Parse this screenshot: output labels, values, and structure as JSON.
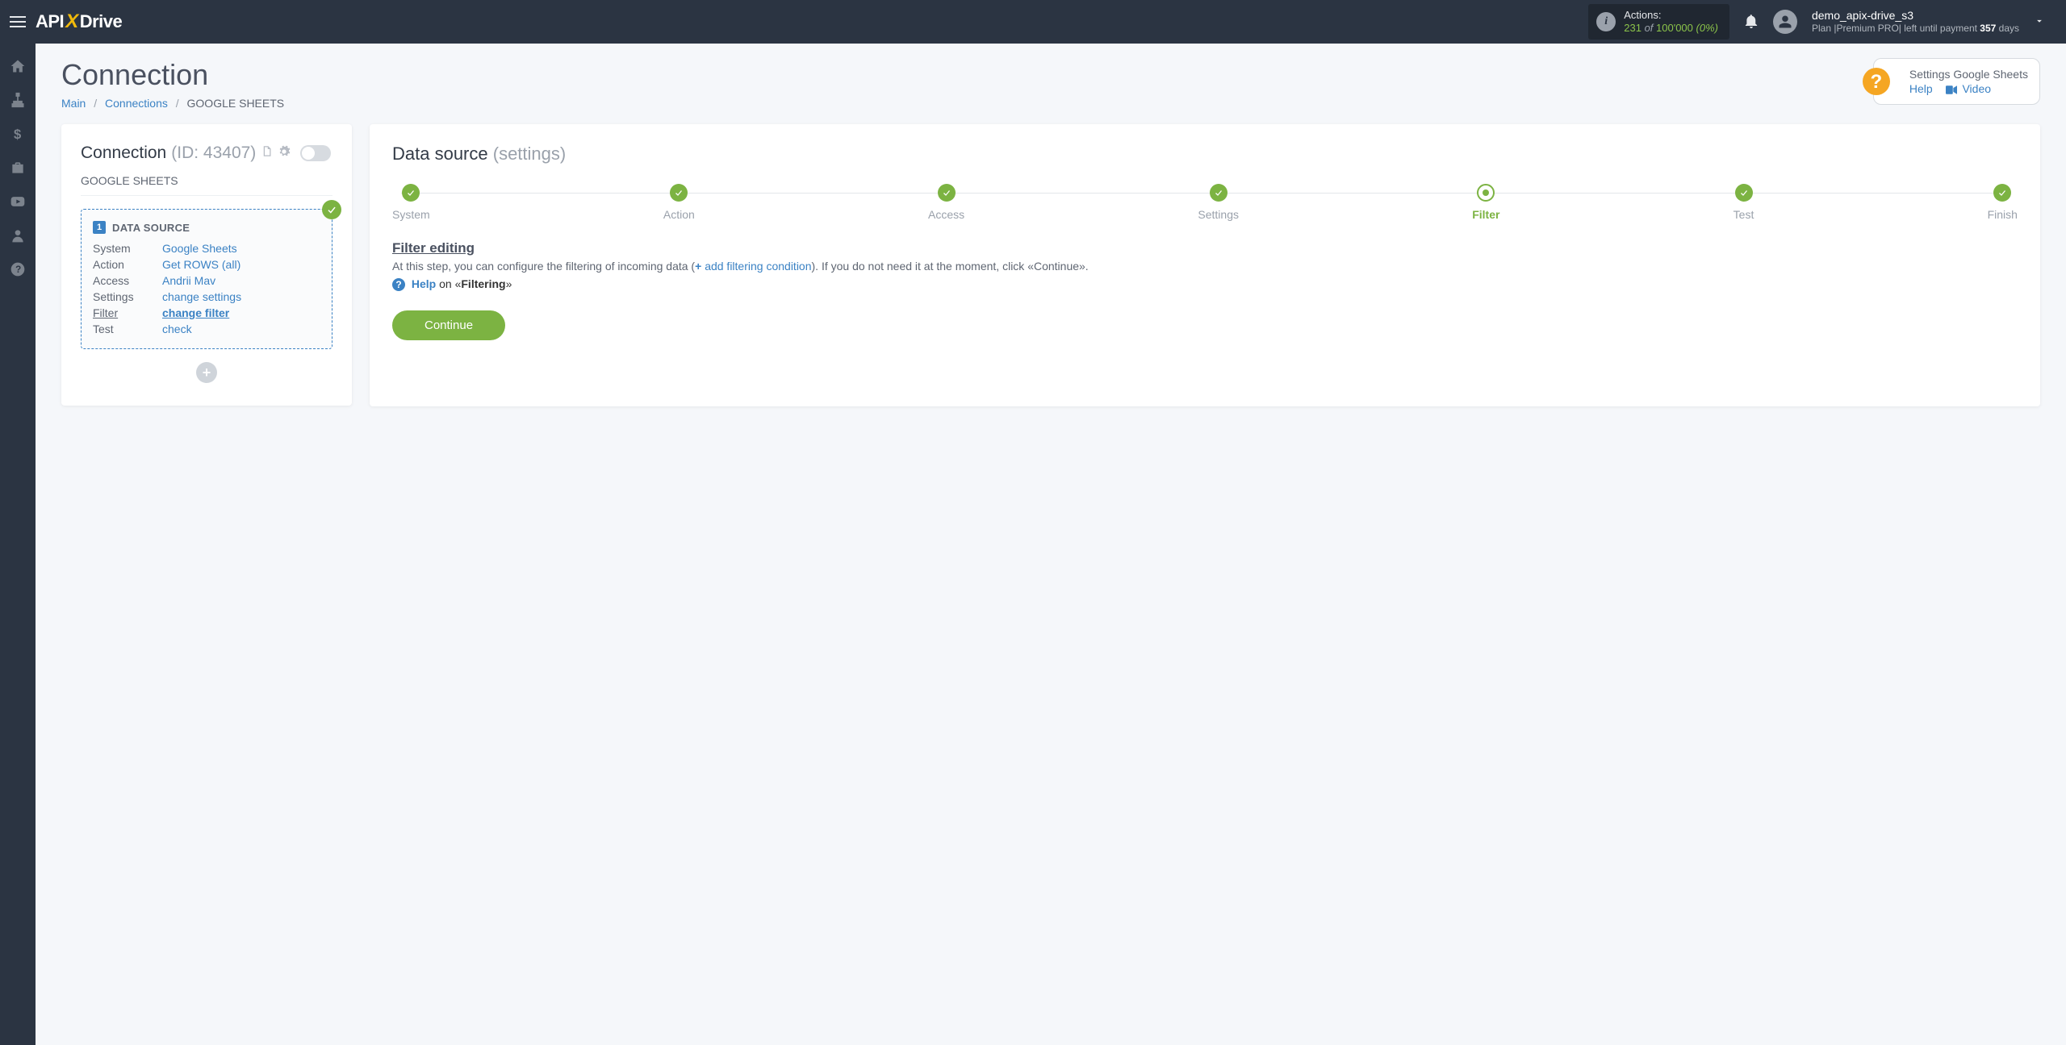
{
  "header": {
    "logo": {
      "api": "API",
      "x": "X",
      "drive": "Drive"
    },
    "actions": {
      "label": "Actions:",
      "used": "231",
      "of": " of ",
      "total": "100'000",
      "pct": " (0%)"
    },
    "user": {
      "name": "demo_apix-drive_s3",
      "plan_prefix": "Plan  |",
      "plan_name": "Premium PRO",
      "plan_mid": "|  left until payment ",
      "days": "357",
      "plan_suffix": " days"
    }
  },
  "page": {
    "title": "Connection",
    "breadcrumb": {
      "main": "Main",
      "connections": "Connections",
      "current": "GOOGLE SHEETS"
    }
  },
  "helpPill": {
    "title": "Settings Google Sheets",
    "help": "Help",
    "video": "Video"
  },
  "leftCard": {
    "title": "Connection",
    "id_label": "(ID: 43407)",
    "subtitle": "GOOGLE SHEETS",
    "ds": {
      "num": "1",
      "title": "DATA SOURCE",
      "rows": [
        {
          "k": "System",
          "v": "Google Sheets"
        },
        {
          "k": "Action",
          "v": "Get ROWS (all)"
        },
        {
          "k": "Access",
          "v": "Andrii Mav"
        },
        {
          "k": "Settings",
          "v": "change settings"
        },
        {
          "k": "Filter",
          "v": "change filter",
          "active": true
        },
        {
          "k": "Test",
          "v": "check"
        }
      ]
    }
  },
  "rightCard": {
    "title": "Data source",
    "title_sub": "(settings)",
    "steps": [
      {
        "label": "System",
        "state": "done"
      },
      {
        "label": "Action",
        "state": "done"
      },
      {
        "label": "Access",
        "state": "done"
      },
      {
        "label": "Settings",
        "state": "done"
      },
      {
        "label": "Filter",
        "state": "active"
      },
      {
        "label": "Test",
        "state": "done"
      },
      {
        "label": "Finish",
        "state": "done"
      }
    ],
    "section_title": "Filter editing",
    "desc_pre": "At this step, you can configure the filtering of incoming data (",
    "desc_link": "add filtering condition",
    "desc_post": "). If you do not need it at the moment, click «Continue».",
    "help_word": "Help",
    "help_mid": " on «",
    "help_topic": "Filtering",
    "help_end": "»",
    "continue": "Continue"
  }
}
